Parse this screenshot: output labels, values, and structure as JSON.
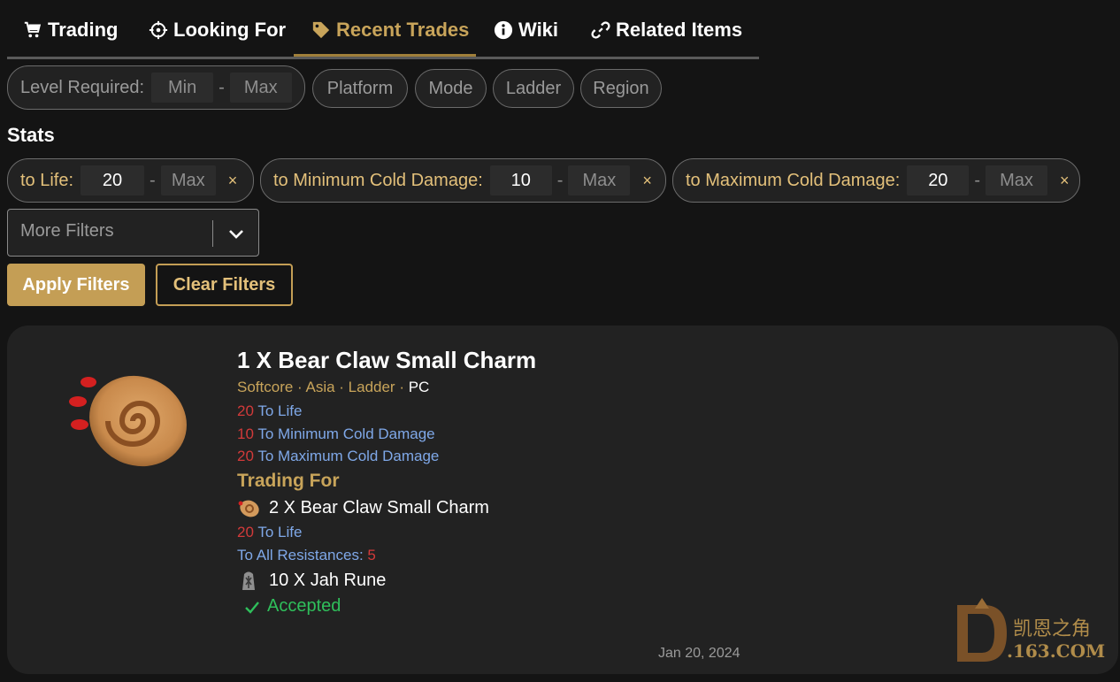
{
  "tabs": [
    {
      "label": "Trading",
      "icon": "cart-icon"
    },
    {
      "label": "Looking For",
      "icon": "crosshair-icon"
    },
    {
      "label": "Recent Trades",
      "icon": "tag-icon"
    },
    {
      "label": "Wiki",
      "icon": "info-icon"
    },
    {
      "label": "Related Items",
      "icon": "link-icon"
    }
  ],
  "filters": {
    "level_label": "Level Required:",
    "level_min_placeholder": "Min",
    "level_max_placeholder": "Max",
    "dash": "-",
    "platform": "Platform",
    "mode": "Mode",
    "ladder": "Ladder",
    "region": "Region"
  },
  "stats": {
    "title": "Stats",
    "items": [
      {
        "label": "to Life:",
        "min": "20",
        "max_placeholder": "Max",
        "remove": "×"
      },
      {
        "label": "to Minimum Cold Damage:",
        "min": "10",
        "max_placeholder": "Max",
        "remove": "×"
      },
      {
        "label": "to Maximum Cold Damage:",
        "min": "20",
        "max_placeholder": "Max",
        "remove": "×"
      }
    ]
  },
  "more_filters": {
    "placeholder": "More Filters"
  },
  "buttons": {
    "apply": "Apply Filters",
    "clear": "Clear Filters"
  },
  "trade": {
    "title": "1 X Bear Claw Small Charm",
    "meta": "Softcore · Asia · Ladder · ",
    "platform": "PC",
    "item_stats": [
      {
        "num": "20",
        "text": "To Life"
      },
      {
        "num": "10",
        "text": "To Minimum Cold Damage"
      },
      {
        "num": "20",
        "text": "To Maximum Cold Damage"
      }
    ],
    "trading_for_label": "Trading For",
    "wanted": [
      {
        "name": "2 X Bear Claw Small Charm",
        "icon": "charm-icon"
      },
      {
        "name": "10 X Jah Rune",
        "icon": "rune-icon"
      }
    ],
    "wanted_stats": [
      {
        "num": "20",
        "text": "To Life"
      },
      {
        "text": "To All Resistances:",
        "num": "5"
      }
    ],
    "status": "Accepted",
    "date": "Jan 20, 2024"
  },
  "watermark": {
    "line1": "凯恩之角",
    "line2": ".163.COM"
  },
  "colors": {
    "gold": "#c8a45a",
    "stat_blue": "#7fa8e8",
    "number_red": "#d23a3a",
    "accepted_green": "#2fbf5b"
  }
}
